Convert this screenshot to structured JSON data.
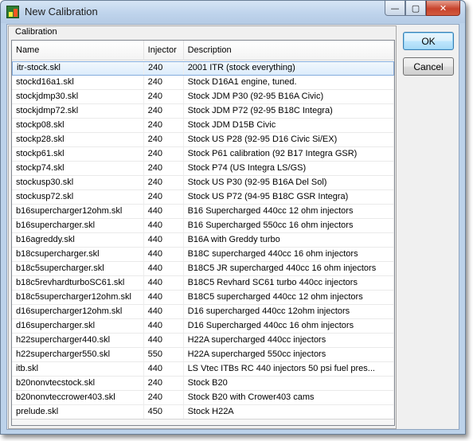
{
  "window": {
    "title": "New Calibration",
    "minimize_glyph": "—",
    "maximize_glyph": "▢",
    "close_glyph": "✕"
  },
  "group": {
    "label": "Calibration"
  },
  "columns": {
    "name": "Name",
    "injector": "Injector",
    "description": "Description"
  },
  "rows": [
    {
      "name": "itr-stock.skl",
      "injector": "240",
      "description": "2001 ITR (stock everything)",
      "selected": true
    },
    {
      "name": "stockd16a1.skl",
      "injector": "240",
      "description": "Stock D16A1 engine, tuned."
    },
    {
      "name": "stockjdmp30.skl",
      "injector": "240",
      "description": "Stock JDM P30 (92-95 B16A Civic)"
    },
    {
      "name": "stockjdmp72.skl",
      "injector": "240",
      "description": "Stock JDM P72 (92-95 B18C Integra)"
    },
    {
      "name": "stockp08.skl",
      "injector": "240",
      "description": "Stock JDM D15B Civic"
    },
    {
      "name": "stockp28.skl",
      "injector": "240",
      "description": "Stock US P28 (92-95 D16 Civic Si/EX)"
    },
    {
      "name": "stockp61.skl",
      "injector": "240",
      "description": "Stock P61 calibration (92 B17 Integra GSR)"
    },
    {
      "name": "stockp74.skl",
      "injector": "240",
      "description": "Stock P74 (US Integra LS/GS)"
    },
    {
      "name": "stockusp30.skl",
      "injector": "240",
      "description": "Stock US P30 (92-95 B16A Del Sol)"
    },
    {
      "name": "stockusp72.skl",
      "injector": "240",
      "description": "Stock US P72 (94-95 B18C GSR Integra)"
    },
    {
      "name": "b16supercharger12ohm.skl",
      "injector": "440",
      "description": "B16 Supercharged  440cc 12 ohm injectors"
    },
    {
      "name": "b16supercharger.skl",
      "injector": "440",
      "description": "B16 Supercharged 550cc 16 ohm injectors"
    },
    {
      "name": "b16agreddy.skl",
      "injector": "440",
      "description": "B16A with Greddy turbo"
    },
    {
      "name": "b18csupercharger.skl",
      "injector": "440",
      "description": "B18C supercharged 440cc 16 ohm injectors"
    },
    {
      "name": "b18c5supercharger.skl",
      "injector": "440",
      "description": "B18C5 JR supercharged 440cc 16 ohm injectors"
    },
    {
      "name": "b18c5revhardturboSC61.skl",
      "injector": "440",
      "description": "B18C5 Revhard SC61 turbo 440cc injectors"
    },
    {
      "name": "b18c5supercharger12ohm.skl",
      "injector": "440",
      "description": "B18C5 supercharged  440cc 12 ohm injectors"
    },
    {
      "name": "d16supercharger12ohm.skl",
      "injector": "440",
      "description": "D16 supercharged  440cc 12ohm injectors"
    },
    {
      "name": "d16supercharger.skl",
      "injector": "440",
      "description": "D16 Supercharged 440cc 16 ohm injectors"
    },
    {
      "name": "h22supercharger440.skl",
      "injector": "440",
      "description": "H22A supercharged 440cc injectors"
    },
    {
      "name": "h22supercharger550.skl",
      "injector": "550",
      "description": "H22A supercharged 550cc injectors"
    },
    {
      "name": "itb.skl",
      "injector": "440",
      "description": "LS Vtec ITBs RC 440 injectors 50 psi fuel pres..."
    },
    {
      "name": "b20nonvtecstock.skl",
      "injector": "240",
      "description": "Stock B20"
    },
    {
      "name": "b20nonvteccrower403.skl",
      "injector": "240",
      "description": "Stock B20 with Crower403 cams"
    },
    {
      "name": "prelude.skl",
      "injector": "450",
      "description": "Stock H22A"
    }
  ],
  "buttons": {
    "ok": "OK",
    "cancel": "Cancel"
  },
  "colors": {
    "selection": "#dcecfb",
    "titlebar": "#bfd4ec",
    "close": "#c7432c"
  }
}
